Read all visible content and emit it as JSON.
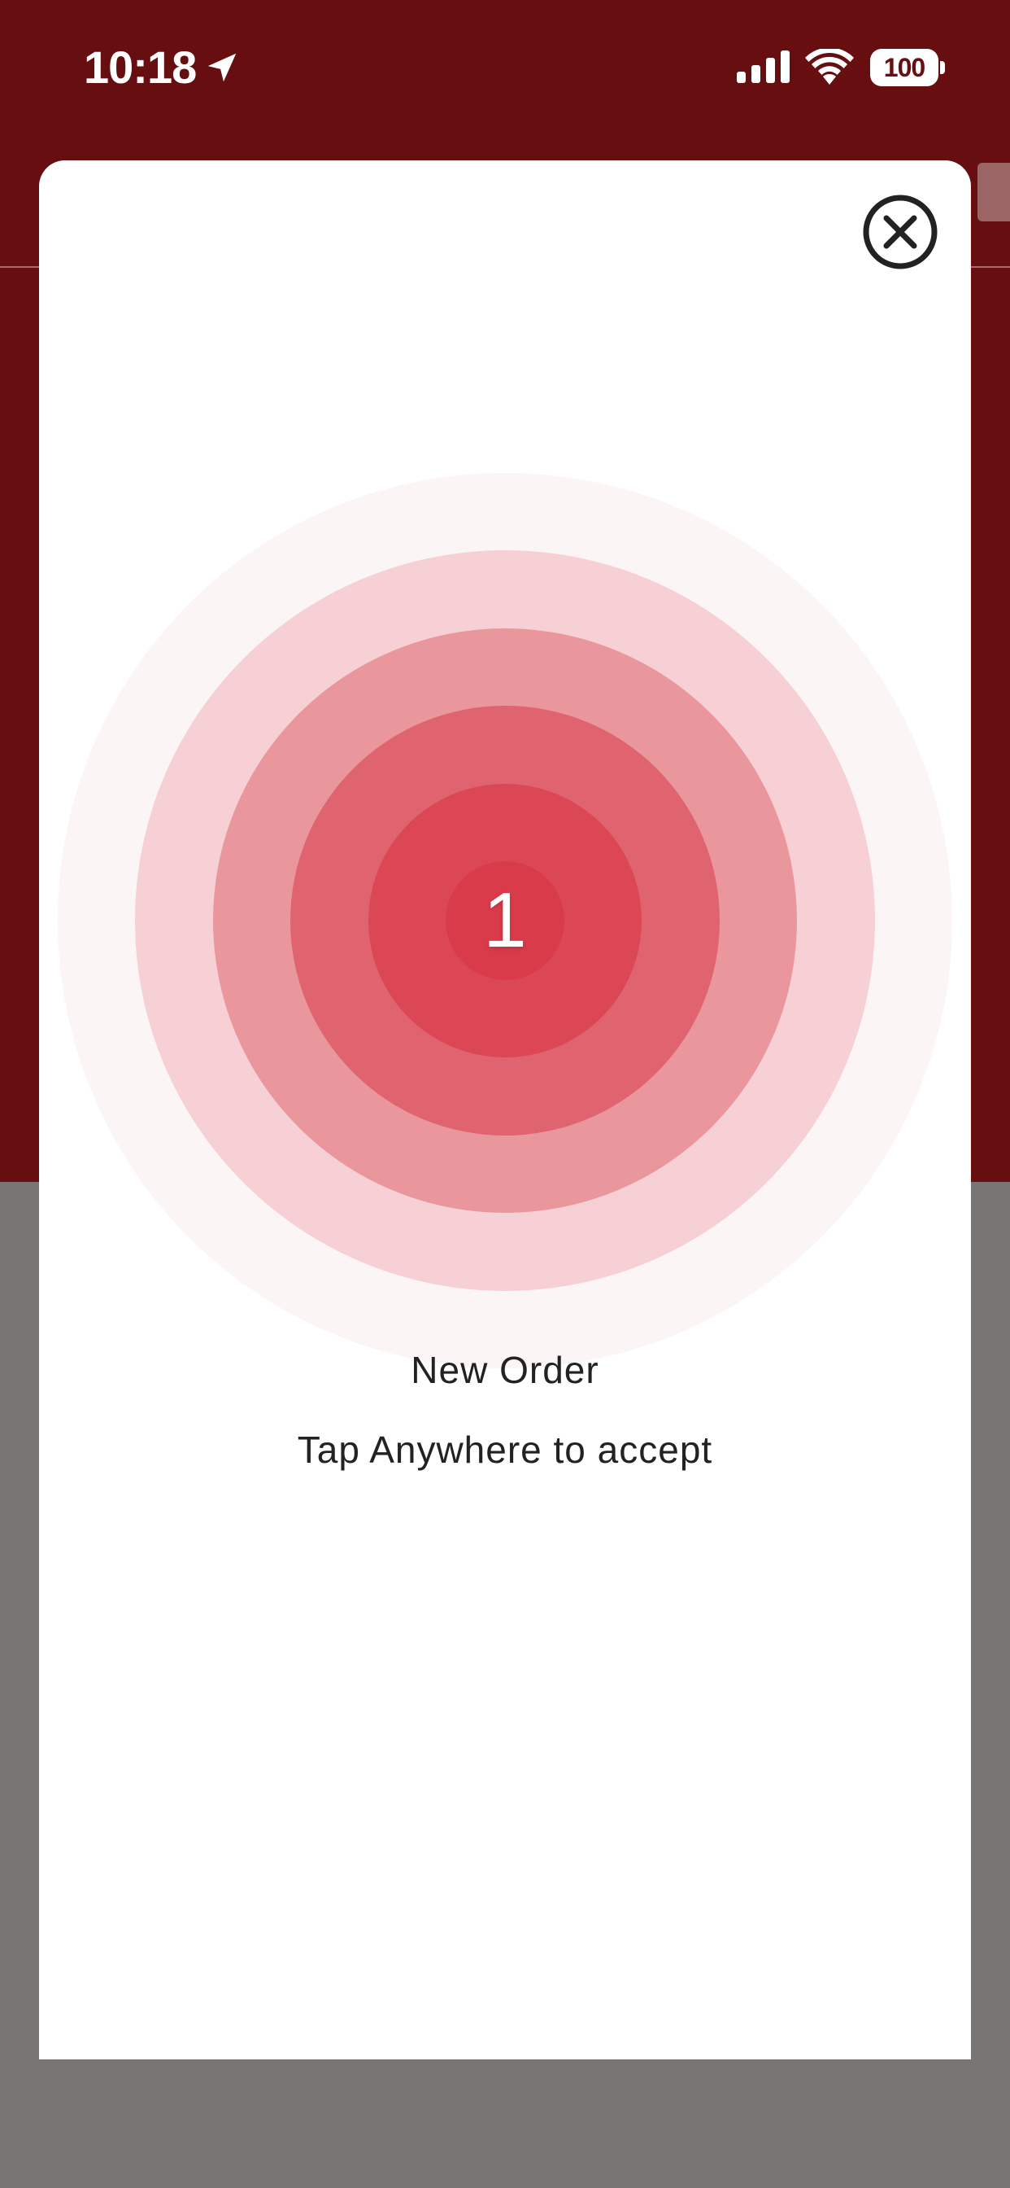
{
  "status_bar": {
    "time": "10:18",
    "battery_level": "100",
    "icons": [
      "location-arrow-icon",
      "cellular-signal-icon",
      "wifi-icon",
      "battery-icon"
    ]
  },
  "modal": {
    "close_icon": "close-circle-icon",
    "order_count": "1",
    "title": "New Order",
    "instruction": "Tap Anywhere to accept"
  },
  "colors": {
    "header_background": "#670E10",
    "overlay_background": "#787575",
    "ripple_ring_1": "#FCF5F5",
    "ripple_ring_2": "#F6D0D5",
    "ripple_ring_3": "#EA969D",
    "ripple_ring_4": "#E06470",
    "ripple_ring_5": "#DB4755",
    "ripple_core": "#D93B4A"
  }
}
